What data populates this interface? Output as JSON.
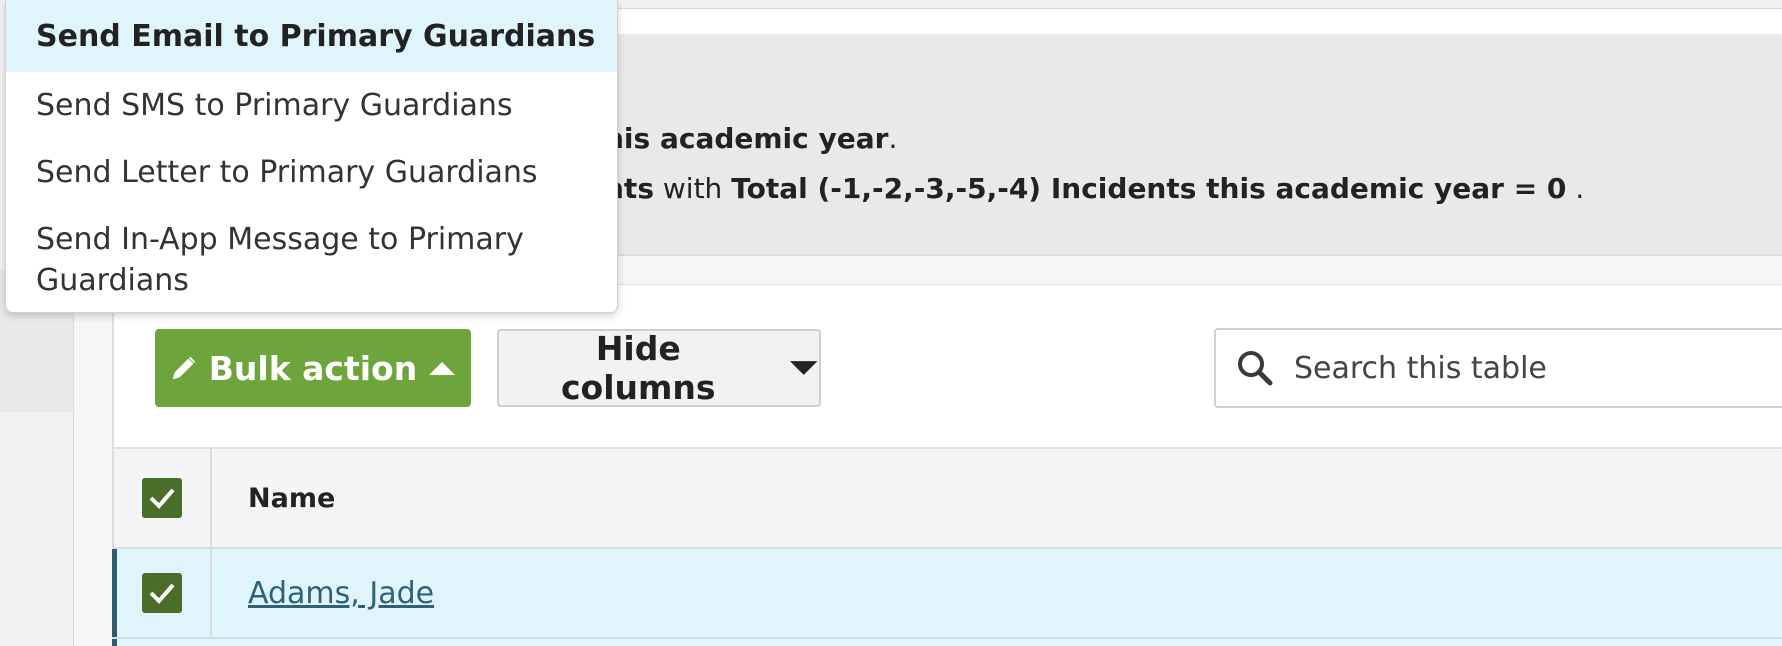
{
  "info": {
    "line1_bold": "his academic year",
    "line1_tail": ".",
    "line2_bold1": "nts",
    "line2_mid": " with ",
    "line2_bold2": "Total (-1,-2,-3,-5,-4) Incidents this academic year = 0",
    "line2_tail": " ."
  },
  "toolbar": {
    "bulk_action_label": "Bulk action",
    "hide_columns_label": "Hide columns",
    "search_placeholder": "Search this table"
  },
  "table": {
    "columns": [
      "Name"
    ],
    "rows": [
      {
        "name": "Adams, Jade",
        "checked": true
      }
    ],
    "select_all_checked": true
  },
  "dropdown": {
    "items": [
      {
        "label": "Send Email to Primary Guardians",
        "active": true
      },
      {
        "label": "Send SMS to Primary Guardians",
        "active": false
      },
      {
        "label": "Send Letter to Primary Guardians",
        "active": false
      },
      {
        "label": "Send In-App Message to Primary Guardians",
        "active": false
      }
    ]
  },
  "colors": {
    "accent_green": "#6ea43c",
    "checkbox_green": "#4a6d2a",
    "row_highlight": "#dff5fb",
    "link": "#2f6278"
  },
  "icons": {
    "bulk_action": "pencil-icon",
    "bulk_action_caret": "caret-up-icon",
    "hide_columns_caret": "caret-down-icon",
    "search": "search-icon",
    "checkbox": "checkmark-icon"
  }
}
